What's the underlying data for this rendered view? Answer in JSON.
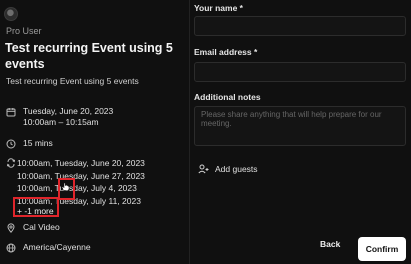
{
  "profile": {
    "name": "Pro User"
  },
  "event": {
    "title": "Test recurring Event using 5 events",
    "description": "Test recurring Event using 5 events",
    "date": "Tuesday, June 20, 2023",
    "time": "10:00am – 10:15am",
    "duration": "15 mins",
    "occurrences": [
      "10:00am, Tuesday, June 20, 2023",
      "10:00am, Tuesday, June 27, 2023",
      "10:00am, Tuesday, July 4, 2023",
      "10:00am, Tuesday, July 11, 2023"
    ],
    "more_label": "+ -1 more",
    "location": "Cal Video",
    "timezone": "America/Cayenne"
  },
  "form": {
    "name_label": "Your name *",
    "name_value": "",
    "email_label": "Email address *",
    "email_value": "",
    "notes_label": "Additional notes",
    "notes_placeholder": "Please share anything that will help prepare for our meeting.",
    "add_guests_label": "Add guests"
  },
  "actions": {
    "back_label": "Back",
    "confirm_label": "Confirm"
  },
  "colors": {
    "background": "#101010",
    "highlight": "#e0252b",
    "confirm_bg": "#ffffff"
  }
}
